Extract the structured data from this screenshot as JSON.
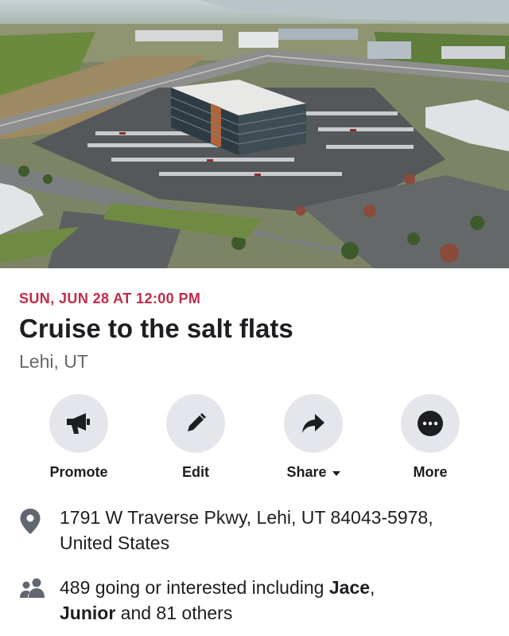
{
  "event": {
    "date_line": "SUN, JUN 28 AT 12:00 PM",
    "title": "Cruise to the salt flats",
    "location_short": "Lehi, UT"
  },
  "cover_photo": {
    "alt": "Aerial photo of an office building surrounded by parking lots and roads"
  },
  "actions": [
    {
      "label": "Promote",
      "icon": "megaphone-icon"
    },
    {
      "label": "Edit",
      "icon": "pencil-icon"
    },
    {
      "label": "Share",
      "icon": "share-arrow-icon"
    },
    {
      "label": "More",
      "icon": "more-dots-icon"
    }
  ],
  "details": {
    "address_line1": "1791 W Traverse Pkwy, Lehi, UT 84043-5978,",
    "address_line2": "United States",
    "attendance_prefix": "489 going or interested including ",
    "attendee_1": "Jace",
    "attendance_sep": ",",
    "attendee_2": "Junior",
    "attendance_suffix": " and 81 others"
  },
  "colors": {
    "date_accent": "#c4294a",
    "button_bg": "#e4e6eb",
    "secondary_text": "#65676b"
  }
}
